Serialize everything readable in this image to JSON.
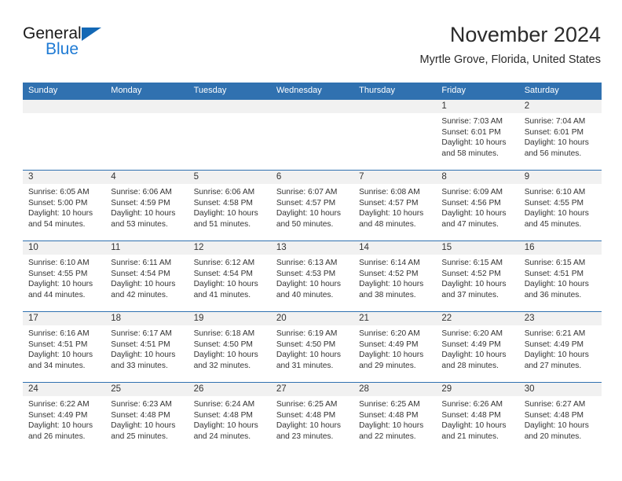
{
  "brand": {
    "line1": "General",
    "line2": "Blue",
    "triangle_color": "#1368b5",
    "text_color": "#1a1a1a",
    "line2_color": "#1e7ad4"
  },
  "header": {
    "title": "November 2024",
    "subtitle": "Myrtle Grove, Florida, United States"
  },
  "theme": {
    "header_blue": "#3071b0",
    "daynum_bg": "#f1f1f1",
    "text": "#333333"
  },
  "weekdays": [
    "Sunday",
    "Monday",
    "Tuesday",
    "Wednesday",
    "Thursday",
    "Friday",
    "Saturday"
  ],
  "weeks": [
    [
      {
        "day": "",
        "sunrise": "",
        "sunset": "",
        "daylight1": "",
        "daylight2": ""
      },
      {
        "day": "",
        "sunrise": "",
        "sunset": "",
        "daylight1": "",
        "daylight2": ""
      },
      {
        "day": "",
        "sunrise": "",
        "sunset": "",
        "daylight1": "",
        "daylight2": ""
      },
      {
        "day": "",
        "sunrise": "",
        "sunset": "",
        "daylight1": "",
        "daylight2": ""
      },
      {
        "day": "",
        "sunrise": "",
        "sunset": "",
        "daylight1": "",
        "daylight2": ""
      },
      {
        "day": "1",
        "sunrise": "Sunrise: 7:03 AM",
        "sunset": "Sunset: 6:01 PM",
        "daylight1": "Daylight: 10 hours",
        "daylight2": "and 58 minutes."
      },
      {
        "day": "2",
        "sunrise": "Sunrise: 7:04 AM",
        "sunset": "Sunset: 6:01 PM",
        "daylight1": "Daylight: 10 hours",
        "daylight2": "and 56 minutes."
      }
    ],
    [
      {
        "day": "3",
        "sunrise": "Sunrise: 6:05 AM",
        "sunset": "Sunset: 5:00 PM",
        "daylight1": "Daylight: 10 hours",
        "daylight2": "and 54 minutes."
      },
      {
        "day": "4",
        "sunrise": "Sunrise: 6:06 AM",
        "sunset": "Sunset: 4:59 PM",
        "daylight1": "Daylight: 10 hours",
        "daylight2": "and 53 minutes."
      },
      {
        "day": "5",
        "sunrise": "Sunrise: 6:06 AM",
        "sunset": "Sunset: 4:58 PM",
        "daylight1": "Daylight: 10 hours",
        "daylight2": "and 51 minutes."
      },
      {
        "day": "6",
        "sunrise": "Sunrise: 6:07 AM",
        "sunset": "Sunset: 4:57 PM",
        "daylight1": "Daylight: 10 hours",
        "daylight2": "and 50 minutes."
      },
      {
        "day": "7",
        "sunrise": "Sunrise: 6:08 AM",
        "sunset": "Sunset: 4:57 PM",
        "daylight1": "Daylight: 10 hours",
        "daylight2": "and 48 minutes."
      },
      {
        "day": "8",
        "sunrise": "Sunrise: 6:09 AM",
        "sunset": "Sunset: 4:56 PM",
        "daylight1": "Daylight: 10 hours",
        "daylight2": "and 47 minutes."
      },
      {
        "day": "9",
        "sunrise": "Sunrise: 6:10 AM",
        "sunset": "Sunset: 4:55 PM",
        "daylight1": "Daylight: 10 hours",
        "daylight2": "and 45 minutes."
      }
    ],
    [
      {
        "day": "10",
        "sunrise": "Sunrise: 6:10 AM",
        "sunset": "Sunset: 4:55 PM",
        "daylight1": "Daylight: 10 hours",
        "daylight2": "and 44 minutes."
      },
      {
        "day": "11",
        "sunrise": "Sunrise: 6:11 AM",
        "sunset": "Sunset: 4:54 PM",
        "daylight1": "Daylight: 10 hours",
        "daylight2": "and 42 minutes."
      },
      {
        "day": "12",
        "sunrise": "Sunrise: 6:12 AM",
        "sunset": "Sunset: 4:54 PM",
        "daylight1": "Daylight: 10 hours",
        "daylight2": "and 41 minutes."
      },
      {
        "day": "13",
        "sunrise": "Sunrise: 6:13 AM",
        "sunset": "Sunset: 4:53 PM",
        "daylight1": "Daylight: 10 hours",
        "daylight2": "and 40 minutes."
      },
      {
        "day": "14",
        "sunrise": "Sunrise: 6:14 AM",
        "sunset": "Sunset: 4:52 PM",
        "daylight1": "Daylight: 10 hours",
        "daylight2": "and 38 minutes."
      },
      {
        "day": "15",
        "sunrise": "Sunrise: 6:15 AM",
        "sunset": "Sunset: 4:52 PM",
        "daylight1": "Daylight: 10 hours",
        "daylight2": "and 37 minutes."
      },
      {
        "day": "16",
        "sunrise": "Sunrise: 6:15 AM",
        "sunset": "Sunset: 4:51 PM",
        "daylight1": "Daylight: 10 hours",
        "daylight2": "and 36 minutes."
      }
    ],
    [
      {
        "day": "17",
        "sunrise": "Sunrise: 6:16 AM",
        "sunset": "Sunset: 4:51 PM",
        "daylight1": "Daylight: 10 hours",
        "daylight2": "and 34 minutes."
      },
      {
        "day": "18",
        "sunrise": "Sunrise: 6:17 AM",
        "sunset": "Sunset: 4:51 PM",
        "daylight1": "Daylight: 10 hours",
        "daylight2": "and 33 minutes."
      },
      {
        "day": "19",
        "sunrise": "Sunrise: 6:18 AM",
        "sunset": "Sunset: 4:50 PM",
        "daylight1": "Daylight: 10 hours",
        "daylight2": "and 32 minutes."
      },
      {
        "day": "20",
        "sunrise": "Sunrise: 6:19 AM",
        "sunset": "Sunset: 4:50 PM",
        "daylight1": "Daylight: 10 hours",
        "daylight2": "and 31 minutes."
      },
      {
        "day": "21",
        "sunrise": "Sunrise: 6:20 AM",
        "sunset": "Sunset: 4:49 PM",
        "daylight1": "Daylight: 10 hours",
        "daylight2": "and 29 minutes."
      },
      {
        "day": "22",
        "sunrise": "Sunrise: 6:20 AM",
        "sunset": "Sunset: 4:49 PM",
        "daylight1": "Daylight: 10 hours",
        "daylight2": "and 28 minutes."
      },
      {
        "day": "23",
        "sunrise": "Sunrise: 6:21 AM",
        "sunset": "Sunset: 4:49 PM",
        "daylight1": "Daylight: 10 hours",
        "daylight2": "and 27 minutes."
      }
    ],
    [
      {
        "day": "24",
        "sunrise": "Sunrise: 6:22 AM",
        "sunset": "Sunset: 4:49 PM",
        "daylight1": "Daylight: 10 hours",
        "daylight2": "and 26 minutes."
      },
      {
        "day": "25",
        "sunrise": "Sunrise: 6:23 AM",
        "sunset": "Sunset: 4:48 PM",
        "daylight1": "Daylight: 10 hours",
        "daylight2": "and 25 minutes."
      },
      {
        "day": "26",
        "sunrise": "Sunrise: 6:24 AM",
        "sunset": "Sunset: 4:48 PM",
        "daylight1": "Daylight: 10 hours",
        "daylight2": "and 24 minutes."
      },
      {
        "day": "27",
        "sunrise": "Sunrise: 6:25 AM",
        "sunset": "Sunset: 4:48 PM",
        "daylight1": "Daylight: 10 hours",
        "daylight2": "and 23 minutes."
      },
      {
        "day": "28",
        "sunrise": "Sunrise: 6:25 AM",
        "sunset": "Sunset: 4:48 PM",
        "daylight1": "Daylight: 10 hours",
        "daylight2": "and 22 minutes."
      },
      {
        "day": "29",
        "sunrise": "Sunrise: 6:26 AM",
        "sunset": "Sunset: 4:48 PM",
        "daylight1": "Daylight: 10 hours",
        "daylight2": "and 21 minutes."
      },
      {
        "day": "30",
        "sunrise": "Sunrise: 6:27 AM",
        "sunset": "Sunset: 4:48 PM",
        "daylight1": "Daylight: 10 hours",
        "daylight2": "and 20 minutes."
      }
    ]
  ]
}
